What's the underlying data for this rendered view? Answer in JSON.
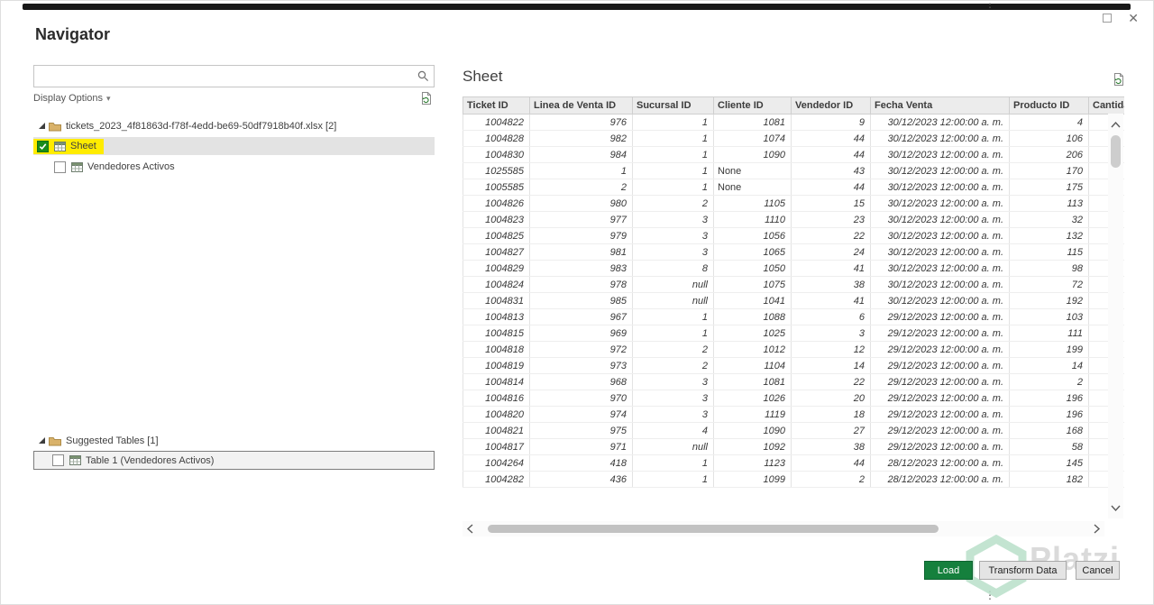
{
  "window": {
    "title": "Navigator"
  },
  "icons": {
    "close": "✕",
    "chevron_down": "▾",
    "drag_dots": "⋮"
  },
  "left_panel": {
    "search_placeholder": "",
    "display_options_label": "Display Options",
    "tree": {
      "source_label": "tickets_2023_4f81863d-f78f-4edd-be69-50df7918b40f.xlsx [2]",
      "sheet_label": "Sheet",
      "vendedores_label": "Vendedores Activos",
      "suggested_label": "Suggested Tables [1]",
      "table1_label": "Table 1 (Vendedores Activos)"
    }
  },
  "preview": {
    "title": "Sheet",
    "table": {
      "columns": [
        "Ticket ID",
        "Linea de Venta ID",
        "Sucursal ID",
        "Cliente ID",
        "Vendedor ID",
        "Fecha Venta",
        "Producto ID",
        "Cantidad"
      ],
      "rows": [
        [
          "1004822",
          "976",
          "1",
          "1081",
          "9",
          "30/12/2023 12:00:00 a. m.",
          "4",
          ""
        ],
        [
          "1004828",
          "982",
          "1",
          "1074",
          "44",
          "30/12/2023 12:00:00 a. m.",
          "106",
          ""
        ],
        [
          "1004830",
          "984",
          "1",
          "1090",
          "44",
          "30/12/2023 12:00:00 a. m.",
          "206",
          ""
        ],
        [
          "1025585",
          "1",
          "1",
          "None",
          "43",
          "30/12/2023 12:00:00 a. m.",
          "170",
          ""
        ],
        [
          "1005585",
          "2",
          "1",
          "None",
          "44",
          "30/12/2023 12:00:00 a. m.",
          "175",
          ""
        ],
        [
          "1004826",
          "980",
          "2",
          "1105",
          "15",
          "30/12/2023 12:00:00 a. m.",
          "113",
          ""
        ],
        [
          "1004823",
          "977",
          "3",
          "1110",
          "23",
          "30/12/2023 12:00:00 a. m.",
          "32",
          ""
        ],
        [
          "1004825",
          "979",
          "3",
          "1056",
          "22",
          "30/12/2023 12:00:00 a. m.",
          "132",
          ""
        ],
        [
          "1004827",
          "981",
          "3",
          "1065",
          "24",
          "30/12/2023 12:00:00 a. m.",
          "115",
          ""
        ],
        [
          "1004829",
          "983",
          "8",
          "1050",
          "41",
          "30/12/2023 12:00:00 a. m.",
          "98",
          ""
        ],
        [
          "1004824",
          "978",
          "null",
          "1075",
          "38",
          "30/12/2023 12:00:00 a. m.",
          "72",
          ""
        ],
        [
          "1004831",
          "985",
          "null",
          "1041",
          "41",
          "30/12/2023 12:00:00 a. m.",
          "192",
          ""
        ],
        [
          "1004813",
          "967",
          "1",
          "1088",
          "6",
          "29/12/2023 12:00:00 a. m.",
          "103",
          ""
        ],
        [
          "1004815",
          "969",
          "1",
          "1025",
          "3",
          "29/12/2023 12:00:00 a. m.",
          "111",
          ""
        ],
        [
          "1004818",
          "972",
          "2",
          "1012",
          "12",
          "29/12/2023 12:00:00 a. m.",
          "199",
          ""
        ],
        [
          "1004819",
          "973",
          "2",
          "1104",
          "14",
          "29/12/2023 12:00:00 a. m.",
          "14",
          ""
        ],
        [
          "1004814",
          "968",
          "3",
          "1081",
          "22",
          "29/12/2023 12:00:00 a. m.",
          "2",
          ""
        ],
        [
          "1004816",
          "970",
          "3",
          "1026",
          "20",
          "29/12/2023 12:00:00 a. m.",
          "196",
          ""
        ],
        [
          "1004820",
          "974",
          "3",
          "1119",
          "18",
          "29/12/2023 12:00:00 a. m.",
          "196",
          ""
        ],
        [
          "1004821",
          "975",
          "4",
          "1090",
          "27",
          "29/12/2023 12:00:00 a. m.",
          "168",
          ""
        ],
        [
          "1004817",
          "971",
          "null",
          "1092",
          "38",
          "29/12/2023 12:00:00 a. m.",
          "58",
          ""
        ],
        [
          "1004264",
          "418",
          "1",
          "1123",
          "44",
          "28/12/2023 12:00:00 a. m.",
          "145",
          ""
        ],
        [
          "1004282",
          "436",
          "1",
          "1099",
          "2",
          "28/12/2023 12:00:00 a. m.",
          "182",
          ""
        ]
      ]
    }
  },
  "footer": {
    "load_label": "Load",
    "transform_label": "Transform Data",
    "cancel_label": "Cancel"
  },
  "watermark": {
    "text": "Platzi"
  },
  "colors": {
    "accent_green": "#15803d",
    "checkbox_green": "#1a8c1a",
    "highlight_yellow": "#ffec00"
  }
}
